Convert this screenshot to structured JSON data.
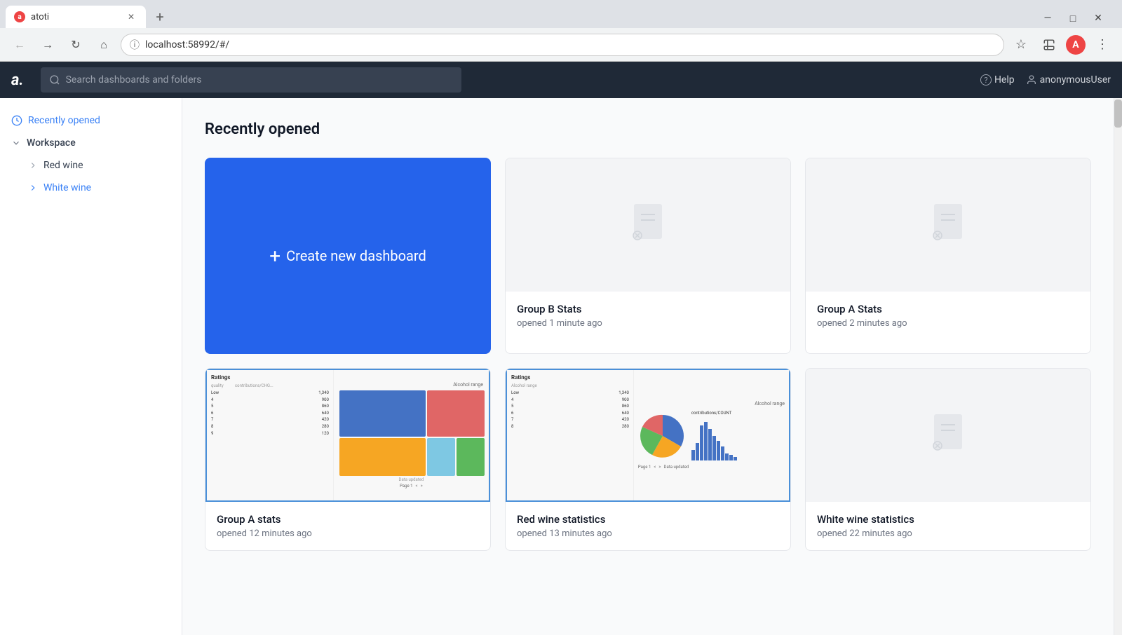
{
  "browser": {
    "tab_title": "atoti",
    "favicon_letter": "a",
    "url": "localhost:58992/#/",
    "new_tab_icon": "+",
    "back_icon": "←",
    "forward_icon": "→",
    "refresh_icon": "↻",
    "home_icon": "⌂",
    "bookmark_icon": "☆",
    "extensions_icon": "🧩",
    "menu_icon": "⋮",
    "window_minimize": "—",
    "window_maximize": "□",
    "window_close": "✕",
    "profile_letter": "A",
    "search_placeholder": "Search dashboards and folders"
  },
  "app": {
    "logo": "a.",
    "search_placeholder": "Search dashboards and folders",
    "help_label": "Help",
    "user_label": "anonymousUser"
  },
  "sidebar": {
    "recently_opened_label": "Recently opened",
    "workspace_label": "Workspace",
    "items": [
      {
        "label": "Red wine"
      },
      {
        "label": "White wine"
      }
    ]
  },
  "main": {
    "page_title": "Recently opened",
    "cards": [
      {
        "id": "create",
        "type": "create",
        "label": "Create new dashboard"
      },
      {
        "id": "group-b-stats",
        "type": "empty",
        "name": "Group B Stats",
        "time": "opened 1 minute ago"
      },
      {
        "id": "group-a-stats",
        "type": "empty",
        "name": "Group A Stats",
        "time": "opened 2 minutes ago"
      },
      {
        "id": "group-a-stats-chart",
        "type": "chart",
        "name": "Group A stats",
        "time": "opened 12 minutes ago"
      },
      {
        "id": "red-wine-stats",
        "type": "pie-chart",
        "name": "Red wine statistics",
        "time": "opened 13 minutes ago"
      },
      {
        "id": "white-wine-stats",
        "type": "empty-small",
        "name": "White wine statistics",
        "time": "opened 22 minutes ago"
      }
    ]
  }
}
